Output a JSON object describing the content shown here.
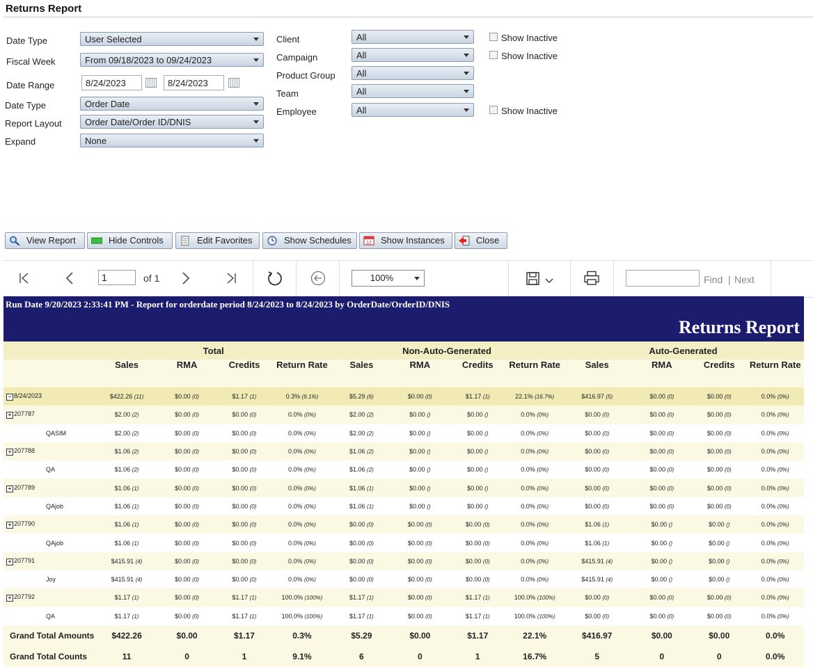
{
  "page_title": "Returns Report",
  "filters": {
    "date_type_label": "Date Type",
    "date_type_value": "User Selected",
    "fiscal_week_label": "Fiscal Week",
    "fiscal_week_value": "From 09/18/2023 to 09/24/2023",
    "date_range_label": "Date Range",
    "date_from": "8/24/2023",
    "date_to": "8/24/2023",
    "date_type2_label": "Date Type",
    "date_type2_value": "Order Date",
    "report_layout_label": "Report Layout",
    "report_layout_value": "Order Date/Order ID/DNIS",
    "expand_label": "Expand",
    "expand_value": "None",
    "client_label": "Client",
    "client_value": "All",
    "campaign_label": "Campaign",
    "campaign_value": "All",
    "product_group_label": "Product Group",
    "product_group_value": "All",
    "team_label": "Team",
    "team_value": "All",
    "employee_label": "Employee",
    "employee_value": "All",
    "show_inactive": "Show Inactive"
  },
  "actions": {
    "view_report": "View Report",
    "hide_controls": "Hide Controls",
    "edit_favorites": "Edit Favorites",
    "show_schedules": "Show Schedules",
    "show_instances": "Show Instances",
    "close": "Close"
  },
  "viewer": {
    "page_number": "1",
    "page_of": "of 1",
    "zoom": "100%",
    "find_placeholder": "",
    "find": "Find",
    "separator": "|",
    "next": "Next"
  },
  "report": {
    "run_line": "Run Date 9/20/2023 2:33:41 PM - Report for orderdate period 8/24/2023 to 8/24/2023 by OrderDate/OrderID/DNIS",
    "name": "Returns Report",
    "groups": [
      "Total",
      "Non-Auto-Generated",
      "Auto-Generated"
    ],
    "columns": [
      "Sales",
      "RMA",
      "Credits",
      "Return Rate"
    ],
    "rows": [
      {
        "label": "8/24/2023",
        "toggle": "−",
        "cells": [
          [
            "$422.26",
            "(11)"
          ],
          [
            "$0.00",
            "(0)"
          ],
          [
            "$1.17",
            "(1)"
          ],
          [
            "0.3%",
            "(9.1%)"
          ],
          [
            "$5.29",
            "(6)"
          ],
          [
            "$0.00",
            "(0)"
          ],
          [
            "$1.17",
            "(1)"
          ],
          [
            "22.1%",
            "(16.7%)"
          ],
          [
            "$416.97",
            "(5)"
          ],
          [
            "$0.00",
            "(0)"
          ],
          [
            "$0.00",
            "(0)"
          ],
          [
            "0.0%",
            "(0%)"
          ]
        ]
      },
      {
        "label": "207787",
        "toggle": "+",
        "cells": [
          [
            "$2.00",
            "(2)"
          ],
          [
            "$0.00",
            "(0)"
          ],
          [
            "$0.00",
            "(0)"
          ],
          [
            "0.0%",
            "(0%)"
          ],
          [
            "$2.00",
            "(2)"
          ],
          [
            "$0.00",
            "()"
          ],
          [
            "$0.00",
            "()"
          ],
          [
            "0.0%",
            "(0%)"
          ],
          [
            "$0.00",
            "(0)"
          ],
          [
            "$0.00",
            "(0)"
          ],
          [
            "$0.00",
            "(0)"
          ],
          [
            "0.0%",
            "(0%)"
          ]
        ]
      },
      {
        "label": "QASIM",
        "toggle": "",
        "cells": [
          [
            "$2.00",
            "(2)"
          ],
          [
            "$0.00",
            "(0)"
          ],
          [
            "$0.00",
            "(0)"
          ],
          [
            "0.0%",
            "(0%)"
          ],
          [
            "$2.00",
            "(2)"
          ],
          [
            "$0.00",
            "()"
          ],
          [
            "$0.00",
            "()"
          ],
          [
            "0.0%",
            "(0%)"
          ],
          [
            "$0.00",
            "(0)"
          ],
          [
            "$0.00",
            "(0)"
          ],
          [
            "$0.00",
            "(0)"
          ],
          [
            "0.0%",
            "(0%)"
          ]
        ]
      },
      {
        "label": "207788",
        "toggle": "+",
        "cells": [
          [
            "$1.06",
            "(2)"
          ],
          [
            "$0.00",
            "(0)"
          ],
          [
            "$0.00",
            "(0)"
          ],
          [
            "0.0%",
            "(0%)"
          ],
          [
            "$1.06",
            "(2)"
          ],
          [
            "$0.00",
            "()"
          ],
          [
            "$0.00",
            "()"
          ],
          [
            "0.0%",
            "(0%)"
          ],
          [
            "$0.00",
            "(0)"
          ],
          [
            "$0.00",
            "(0)"
          ],
          [
            "$0.00",
            "(0)"
          ],
          [
            "0.0%",
            "(0%)"
          ]
        ]
      },
      {
        "label": "QA",
        "toggle": "",
        "cells": [
          [
            "$1.06",
            "(2)"
          ],
          [
            "$0.00",
            "(0)"
          ],
          [
            "$0.00",
            "(0)"
          ],
          [
            "0.0%",
            "(0%)"
          ],
          [
            "$1.06",
            "(2)"
          ],
          [
            "$0.00",
            "()"
          ],
          [
            "$0.00",
            "()"
          ],
          [
            "0.0%",
            "(0%)"
          ],
          [
            "$0.00",
            "(0)"
          ],
          [
            "$0.00",
            "(0)"
          ],
          [
            "$0.00",
            "(0)"
          ],
          [
            "0.0%",
            "(0%)"
          ]
        ]
      },
      {
        "label": "207789",
        "toggle": "+",
        "cells": [
          [
            "$1.06",
            "(1)"
          ],
          [
            "$0.00",
            "(0)"
          ],
          [
            "$0.00",
            "(0)"
          ],
          [
            "0.0%",
            "(0%)"
          ],
          [
            "$1.06",
            "(1)"
          ],
          [
            "$0.00",
            "()"
          ],
          [
            "$0.00",
            "()"
          ],
          [
            "0.0%",
            "(0%)"
          ],
          [
            "$0.00",
            "(0)"
          ],
          [
            "$0.00",
            "(0)"
          ],
          [
            "$0.00",
            "(0)"
          ],
          [
            "0.0%",
            "(0%)"
          ]
        ]
      },
      {
        "label": "QAjob",
        "toggle": "",
        "cells": [
          [
            "$1.06",
            "(1)"
          ],
          [
            "$0.00",
            "(0)"
          ],
          [
            "$0.00",
            "(0)"
          ],
          [
            "0.0%",
            "(0%)"
          ],
          [
            "$1.06",
            "(1)"
          ],
          [
            "$0.00",
            "()"
          ],
          [
            "$0.00",
            "()"
          ],
          [
            "0.0%",
            "(0%)"
          ],
          [
            "$0.00",
            "(0)"
          ],
          [
            "$0.00",
            "(0)"
          ],
          [
            "$0.00",
            "(0)"
          ],
          [
            "0.0%",
            "(0%)"
          ]
        ]
      },
      {
        "label": "207790",
        "toggle": "+",
        "cells": [
          [
            "$1.06",
            "(1)"
          ],
          [
            "$0.00",
            "(0)"
          ],
          [
            "$0.00",
            "(0)"
          ],
          [
            "0.0%",
            "(0%)"
          ],
          [
            "$0.00",
            "(0)"
          ],
          [
            "$0.00",
            "(0)"
          ],
          [
            "$0.00",
            "(0)"
          ],
          [
            "0.0%",
            "(0%)"
          ],
          [
            "$1.06",
            "(1)"
          ],
          [
            "$0.00",
            "()"
          ],
          [
            "$0.00",
            "()"
          ],
          [
            "0.0%",
            "(0%)"
          ]
        ]
      },
      {
        "label": "QAjob",
        "toggle": "",
        "cells": [
          [
            "$1.06",
            "(1)"
          ],
          [
            "$0.00",
            "(0)"
          ],
          [
            "$0.00",
            "(0)"
          ],
          [
            "0.0%",
            "(0%)"
          ],
          [
            "$0.00",
            "(0)"
          ],
          [
            "$0.00",
            "(0)"
          ],
          [
            "$0.00",
            "(0)"
          ],
          [
            "0.0%",
            "(0%)"
          ],
          [
            "$1.06",
            "(1)"
          ],
          [
            "$0.00",
            "()"
          ],
          [
            "$0.00",
            "()"
          ],
          [
            "0.0%",
            "(0%)"
          ]
        ]
      },
      {
        "label": "207791",
        "toggle": "+",
        "cells": [
          [
            "$415.91",
            "(4)"
          ],
          [
            "$0.00",
            "(0)"
          ],
          [
            "$0.00",
            "(0)"
          ],
          [
            "0.0%",
            "(0%)"
          ],
          [
            "$0.00",
            "(0)"
          ],
          [
            "$0.00",
            "(0)"
          ],
          [
            "$0.00",
            "(0)"
          ],
          [
            "0.0%",
            "(0%)"
          ],
          [
            "$415.91",
            "(4)"
          ],
          [
            "$0.00",
            "()"
          ],
          [
            "$0.00",
            "()"
          ],
          [
            "0.0%",
            "(0%)"
          ]
        ]
      },
      {
        "label": "Joy",
        "toggle": "",
        "cells": [
          [
            "$415.91",
            "(4)"
          ],
          [
            "$0.00",
            "(0)"
          ],
          [
            "$0.00",
            "(0)"
          ],
          [
            "0.0%",
            "(0%)"
          ],
          [
            "$0.00",
            "(0)"
          ],
          [
            "$0.00",
            "(0)"
          ],
          [
            "$0.00",
            "(0)"
          ],
          [
            "0.0%",
            "(0%)"
          ],
          [
            "$415.91",
            "(4)"
          ],
          [
            "$0.00",
            "()"
          ],
          [
            "$0.00",
            "()"
          ],
          [
            "0.0%",
            "(0%)"
          ]
        ]
      },
      {
        "label": "207792",
        "toggle": "+",
        "cells": [
          [
            "$1.17",
            "(1)"
          ],
          [
            "$0.00",
            "(0)"
          ],
          [
            "$1.17",
            "(1)"
          ],
          [
            "100.0%",
            "(100%)"
          ],
          [
            "$1.17",
            "(1)"
          ],
          [
            "$0.00",
            "(0)"
          ],
          [
            "$1.17",
            "(1)"
          ],
          [
            "100.0%",
            "(100%)"
          ],
          [
            "$0.00",
            "(0)"
          ],
          [
            "$0.00",
            "(0)"
          ],
          [
            "$0.00",
            "(0)"
          ],
          [
            "0.0%",
            "(0%)"
          ]
        ]
      },
      {
        "label": "QA",
        "toggle": "",
        "cells": [
          [
            "$1.17",
            "(1)"
          ],
          [
            "$0.00",
            "(0)"
          ],
          [
            "$1.17",
            "(1)"
          ],
          [
            "100.0%",
            "(100%)"
          ],
          [
            "$1.17",
            "(1)"
          ],
          [
            "$0.00",
            "(0)"
          ],
          [
            "$1.17",
            "(1)"
          ],
          [
            "100.0%",
            "(100%)"
          ],
          [
            "$0.00",
            "(0)"
          ],
          [
            "$0.00",
            "(0)"
          ],
          [
            "$0.00",
            "(0)"
          ],
          [
            "0.0%",
            "(0%)"
          ]
        ]
      }
    ],
    "totals": [
      {
        "label": "Grand Total Amounts",
        "values": [
          "$422.26",
          "$0.00",
          "$1.17",
          "0.3%",
          "$5.29",
          "$0.00",
          "$1.17",
          "22.1%",
          "$416.97",
          "$0.00",
          "$0.00",
          "0.0%"
        ]
      },
      {
        "label": "Grand Total Counts",
        "values": [
          "11",
          "0",
          "1",
          "9.1%",
          "6",
          "0",
          "1",
          "16.7%",
          "5",
          "0",
          "0",
          "0.0%"
        ]
      }
    ]
  }
}
